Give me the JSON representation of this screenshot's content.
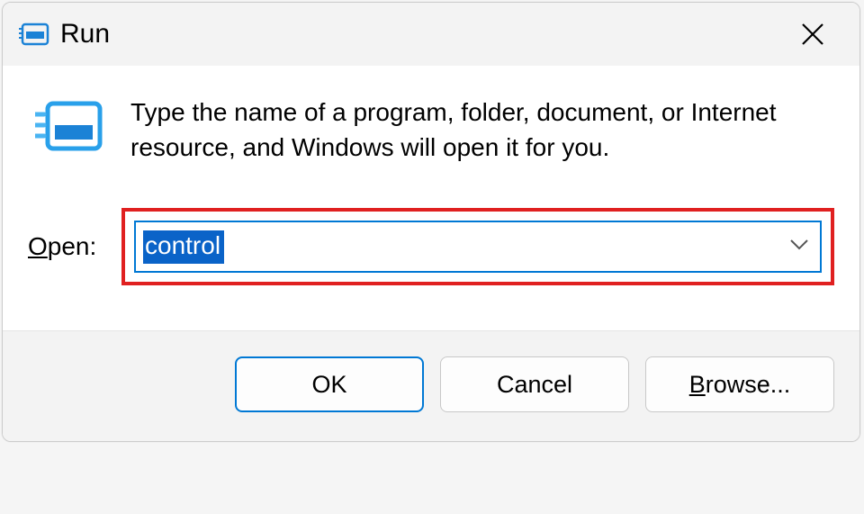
{
  "title": "Run",
  "description": "Type the name of a program, folder, document, or Internet resource, and Windows will open it for you.",
  "open": {
    "label_pre": "O",
    "label_rest": "pen:",
    "value": "control"
  },
  "buttons": {
    "ok": "OK",
    "cancel": "Cancel",
    "browse_pre": "B",
    "browse_rest": "rowse..."
  }
}
